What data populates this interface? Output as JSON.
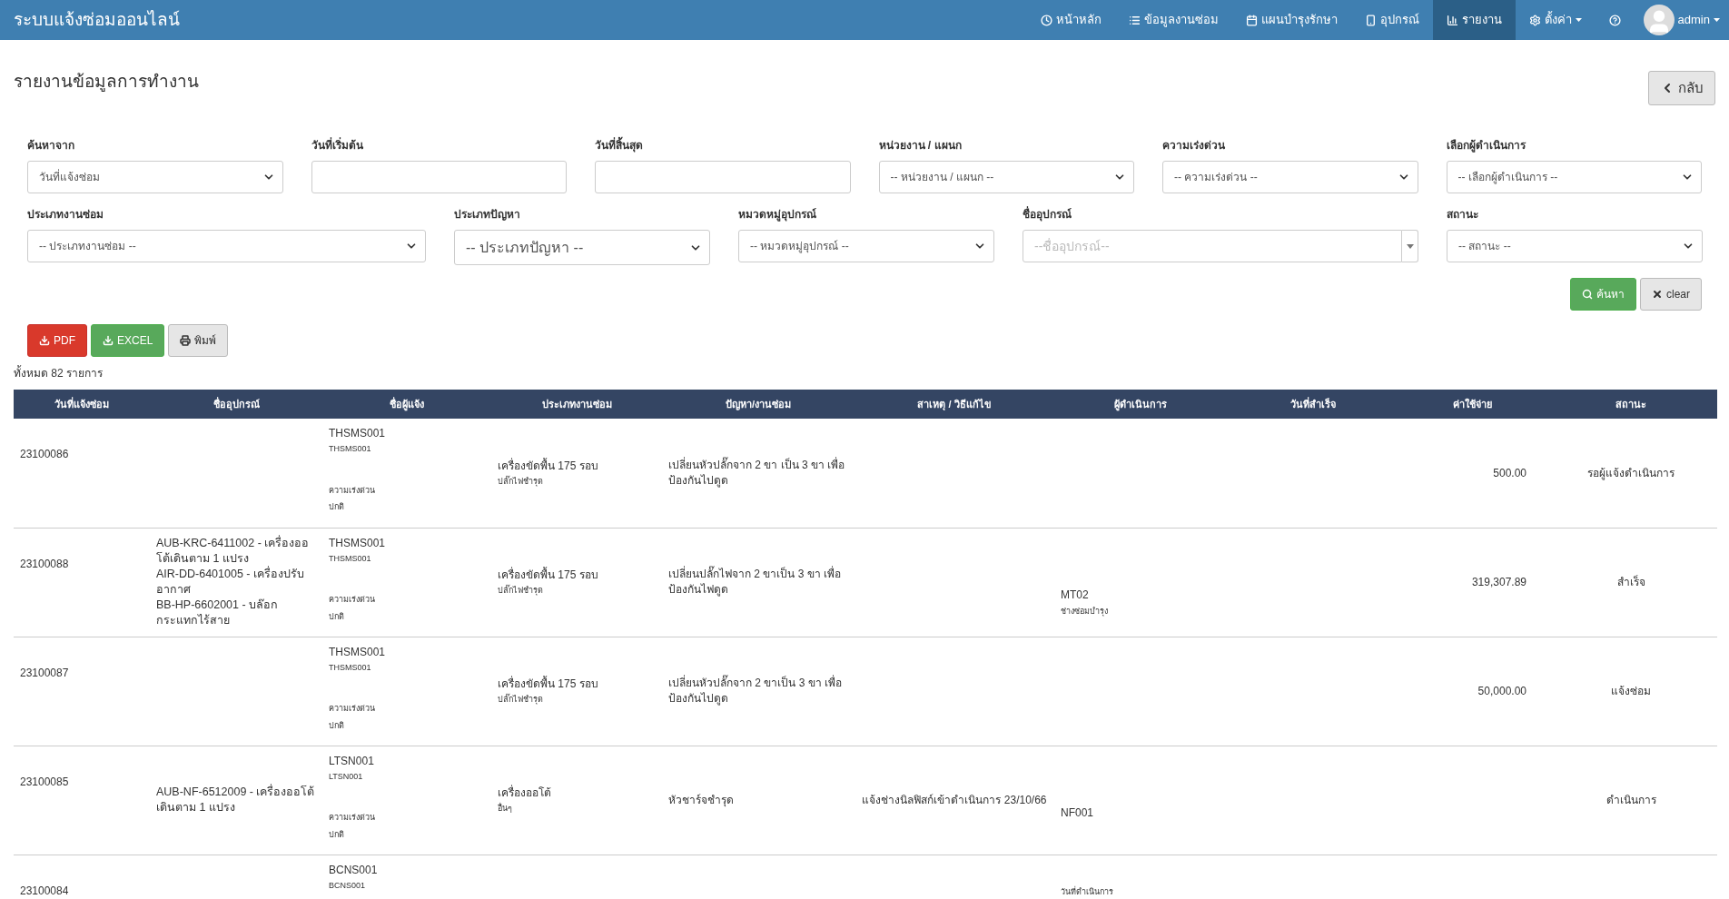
{
  "navbar": {
    "brand": "ระบบแจ้งซ่อมออนไลน์",
    "items": [
      {
        "label": "หน้าหลัก",
        "selected": false
      },
      {
        "label": "ข้อมูลงานซ่อม",
        "selected": false
      },
      {
        "label": "แผนบำรุงรักษา",
        "selected": false
      },
      {
        "label": "อุปกรณ์",
        "selected": false
      },
      {
        "label": "รายงาน",
        "selected": true
      },
      {
        "label": "ตั้งค่า",
        "selected": false,
        "dropdown": true
      },
      {
        "selected": false
      }
    ],
    "user": {
      "name": "admin"
    }
  },
  "page": {
    "title": "รายงานข้อมูลการทำงาน",
    "back_button": "กลับ"
  },
  "filters_row_1": [
    {
      "label": "ค้นหาจาก",
      "kind": "select",
      "value": "วันที่แจ้งซ่อม"
    },
    {
      "label": "วันที่เริ่มต้น",
      "kind": "input"
    },
    {
      "label": "วันที่สิ้นสุด",
      "kind": "input"
    },
    {
      "label": "หน่วยงาน / แผนก",
      "kind": "select",
      "value": "-- หน่วยงาน / แผนก --"
    },
    {
      "label": "ความเร่งด่วน",
      "kind": "select",
      "value": "-- ความเร่งด่วน --"
    },
    {
      "label": "เลือกผู้ดำเนินการ",
      "kind": "select",
      "value": "-- เลือกผู้ดำเนินการ --"
    }
  ],
  "filters_row_2": [
    {
      "label": "ประเภทงานซ่อม",
      "kind": "select",
      "value": "-- ประเภทงานซ่อม --"
    },
    {
      "label": "ประเภทปัญหา",
      "kind": "select_large",
      "value": "-- ประเภทปัญหา --"
    },
    {
      "label": "หมวดหมู่อุปกรณ์",
      "kind": "select",
      "value": "-- หมวดหมู่อุปกรณ์ --"
    },
    {
      "label": "ชื่ออุปกรณ์",
      "kind": "combo",
      "placeholder": "--ชื่ออุปกรณ์--"
    },
    {
      "label": "สถานะ",
      "kind": "select",
      "value": "-- สถานะ --"
    }
  ],
  "search_button": "ค้นหา",
  "clear_button": "clear",
  "export_buttons": [
    {
      "label": "PDF",
      "kind": "pdf"
    },
    {
      "label": "EXCEL",
      "kind": "excel"
    },
    {
      "label": "พิมพ์",
      "kind": "print"
    }
  ],
  "total": "ทั้งหมด 82 รายการ",
  "table": {
    "columns": [
      "วันที่แจ้งซ่อม",
      "ชื่ออุปกรณ์",
      "ชื่อผู้แจ้ง",
      "ประเภทงานซ่อม",
      "ปัญหา/งานซ่อม",
      "สาเหตุ / วิธีแก้ไข",
      "ผู้ดำเนินการ",
      "วันที่สำเร็จ",
      "ค่าใช้จ่าย",
      "สถานะ"
    ],
    "rows": [
      {
        "date": "23100086",
        "reporter": {
          "code": "THSMS001",
          "sub": "THSMS001",
          "urgency_label": "ความเร่งด่วน",
          "urgency": "ปกติ"
        },
        "type": {
          "main": "เครื่องขัดพื้น 175 รอบ",
          "sub": "ปลั๊กไฟชำรุด"
        },
        "problem": "เปลี่ยนหัวปลั๊กจาก 2 ขา เป็น 3 ขา เพื่อป้องกันไปดูด",
        "cost": "500.00",
        "status": "รอผู้แจ้งดำเนินการ"
      },
      {
        "date": "23100088",
        "equipment": [
          "AUB-KRC-6411002 - เครื่องออโต้เดินตาม 1 แปรง",
          "AIR-DD-6401005 - เครื่องปรับอากาศ",
          "BB-HP-6602001 - บล๊อกกระแทกไร้สาย"
        ],
        "reporter": {
          "code": "THSMS001",
          "sub": "THSMS001",
          "urgency_label": "ความเร่งด่วน",
          "urgency": "ปกติ"
        },
        "type": {
          "main": "เครื่องขัดพื้น 175 รอบ",
          "sub": "ปลั๊กไฟชำรุด"
        },
        "problem": "เปลี่ยนปลั๊กไฟจาก 2 ขาเป็น 3 ขา เพื่อป้องกันไฟดูด",
        "operator": {
          "code": "MT02",
          "sub": "ช่างซ่อมบำรุง"
        },
        "cost": "319,307.89",
        "status": "สำเร็จ"
      },
      {
        "date": "23100087",
        "reporter": {
          "code": "THSMS001",
          "sub": "THSMS001",
          "urgency_label": "ความเร่งด่วน",
          "urgency": "ปกติ"
        },
        "type": {
          "main": "เครื่องขัดพื้น 175 รอบ",
          "sub": "ปลั๊กไฟชำรุด"
        },
        "problem": "เปลี่ยนหัวปลั๊กจาก 2 ขาเป็น 3 ขา เพื่อป้องกันไปดูด",
        "cost": "50,000.00",
        "status": "แจ้งซ่อม"
      },
      {
        "date": "23100085",
        "equipment": [
          "AUB-NF-6512009 - เครื่องออโต้เดินตาม 1 แปรง"
        ],
        "reporter": {
          "code": "LTSN001",
          "sub": "LTSN001",
          "urgency_label": "ความเร่งด่วน",
          "urgency": "ปกติ"
        },
        "type": {
          "main": "เครื่องออโต้",
          "sub": "อื่นๆ"
        },
        "problem": "หัวชาร์จชำรุด",
        "cause": "แจ้งช่างนิลฟิสก์เข้าดำเนินการ 23/10/66",
        "operator": {
          "code": "NF001"
        },
        "status": "ดำเนินการ"
      },
      {
        "date": "23100084",
        "reporter": {
          "code": "BCNS001",
          "sub": "BCNS001"
        },
        "operator": {
          "label": "วันที่ดำเนินการ"
        }
      }
    ]
  }
}
